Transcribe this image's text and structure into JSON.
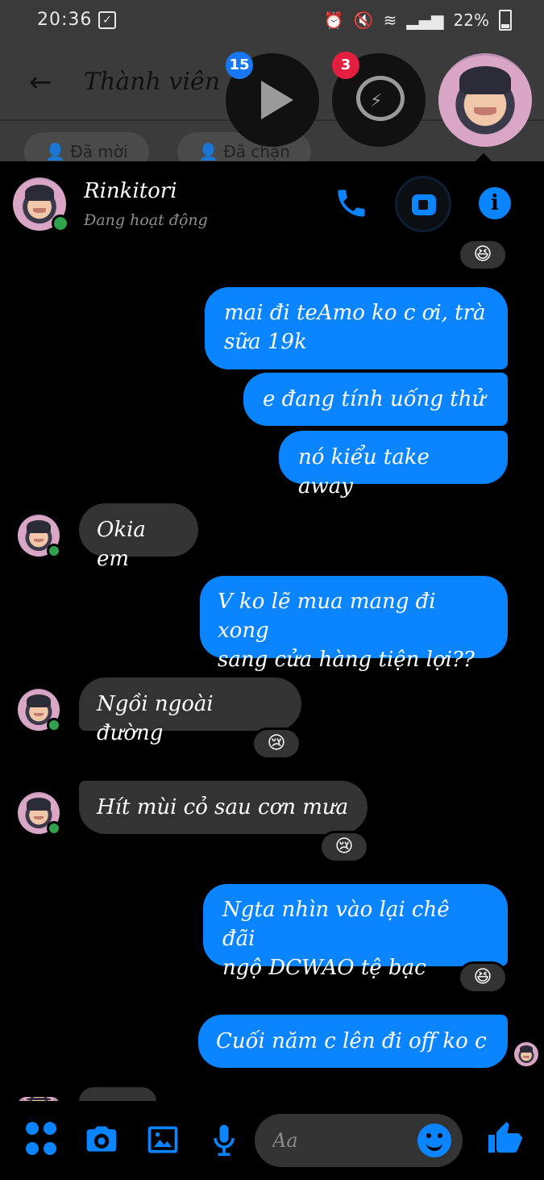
{
  "status_bar": {
    "time": "20:36",
    "battery": "22%"
  },
  "background_app": {
    "title": "Thành viên",
    "pills": [
      "Đã mời",
      "Đã chặn"
    ]
  },
  "chat_heads": [
    {
      "badge": "15",
      "badge_color": "#1877f2"
    },
    {
      "badge": "3",
      "badge_color": "#e41e3f"
    }
  ],
  "conversation": {
    "name": "Rinkitori",
    "status": "Đang hoạt động"
  },
  "reactions": {
    "laugh": "😆",
    "cry": "😢"
  },
  "messages": [
    {
      "text_lines": [
        "mai đi teAmo ko c ơi, trà",
        "sữa 19k"
      ]
    },
    {
      "text": "e đang tính uống thử"
    },
    {
      "text": "nó kiểu take away"
    },
    {
      "text": "Okia em"
    },
    {
      "text_lines": [
        "V ko lẽ mua mang đi xong",
        "sang cửa hàng tiện lợi??"
      ]
    },
    {
      "text": "Ngồi ngoài đường"
    },
    {
      "text": "Hít mùi cỏ sau cơn mưa"
    },
    {
      "text_lines": [
        "Ngta nhìn vào lại chê đãi",
        "ngộ DCWAO tệ bạc"
      ]
    },
    {
      "text": "Cuối năm c lên đi off ko c"
    }
  ],
  "composer": {
    "placeholder": "Aa"
  },
  "colors": {
    "accent": "#0a84ff",
    "incoming": "#333333",
    "online": "#31a24c"
  }
}
